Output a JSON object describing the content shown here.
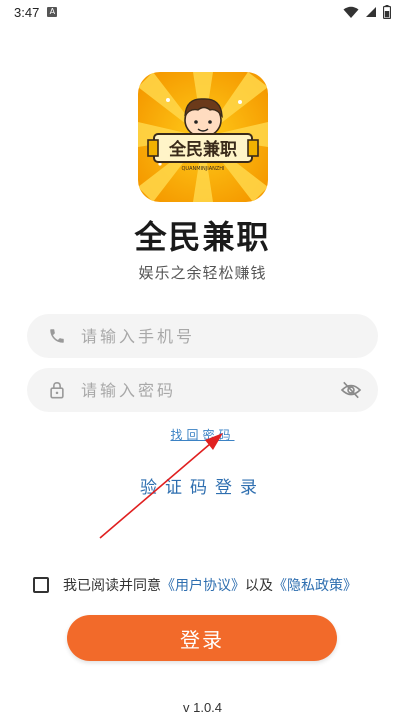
{
  "status": {
    "time": "3:47",
    "notif_letter": "A"
  },
  "app": {
    "name": "全民兼职",
    "slogan": "娱乐之余轻松赚钱",
    "logo_text": "全民兼职",
    "logo_subtext": "QUANMINJIANZHI"
  },
  "form": {
    "phone_placeholder": "请输入手机号",
    "password_placeholder": "请输入密码"
  },
  "links": {
    "forgot": "找回密码",
    "sms_login": "验证码登录"
  },
  "agreement": {
    "prefix": "我已阅读并同意",
    "user_agreement": "《用户协议》",
    "and": "以及",
    "privacy_policy": "《隐私政策》",
    "checked": false
  },
  "login_button": "登录",
  "version": "v 1.0.4",
  "colors": {
    "primary": "#f26a2a",
    "link": "#2f6fb0",
    "logo_bg": "#f7a400",
    "annotation": "#e02020"
  }
}
